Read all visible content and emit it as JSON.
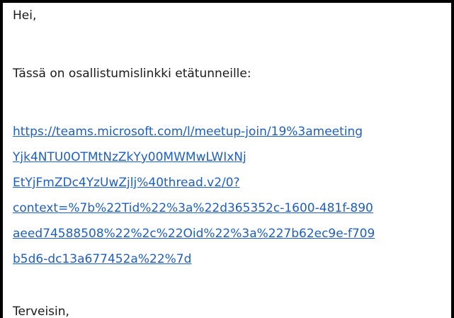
{
  "email": {
    "greeting": "Hei,",
    "intro": "Tässä on osallistumislinkki etätunneille:",
    "link_lines": [
      "https://teams.microsoft.com/l/meetup-join/19%3ameeting",
      "Yjk4NTU0OTMtNzZkYy00MWMwLWIxNj",
      "EtYjFmZDc4YzUwZjlj%40thread.v2/0?",
      "context=%7b%22Tid%22%3a%22d365352c-1600-481f-890",
      "aeed74588508%22%2c%22Oid%22%3a%227b62ec9e-f709",
      "b5d6-dc13a677452a%22%7d"
    ],
    "signoff": "Terveisin,"
  },
  "colors": {
    "link": "#1f5fbf",
    "text": "#1a1a1a",
    "border": "#000000"
  }
}
